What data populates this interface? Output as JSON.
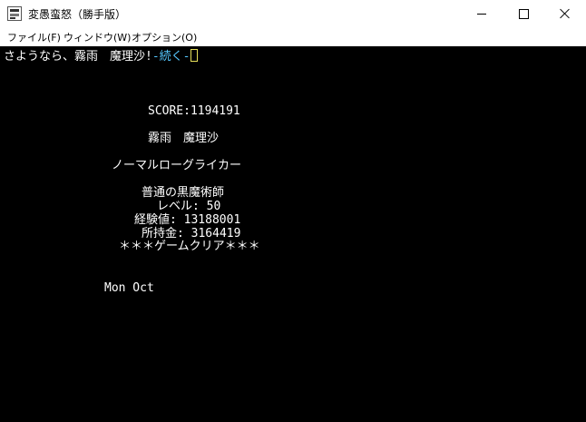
{
  "window": {
    "title": "変愚蛮怒（勝手版）",
    "icon": "app-icon"
  },
  "menu": [
    {
      "label": "ファイル(F)"
    },
    {
      "label": "ウィンドウ(W)"
    },
    {
      "label": "オプション(O)"
    }
  ],
  "console": {
    "message": "さようなら、霧雨　魔理沙!",
    "continue_prompt": "-続く-",
    "score": "SCORE:1194191",
    "player_name": "霧雨　魔理沙",
    "race": "ノーマルローグライカー",
    "title": "普通の黒魔術師",
    "level": "レベル: 50",
    "experience": "経験値: 13188001",
    "gold": "所持金: 3164419",
    "status": "＊＊＊ゲームクリア＊＊＊",
    "date": "Mon Oct"
  },
  "colors": {
    "console_bg": "#000000",
    "console_text": "#ffffff",
    "continue_prompt": "#56c8ff",
    "cursor": "#e7e05a"
  }
}
